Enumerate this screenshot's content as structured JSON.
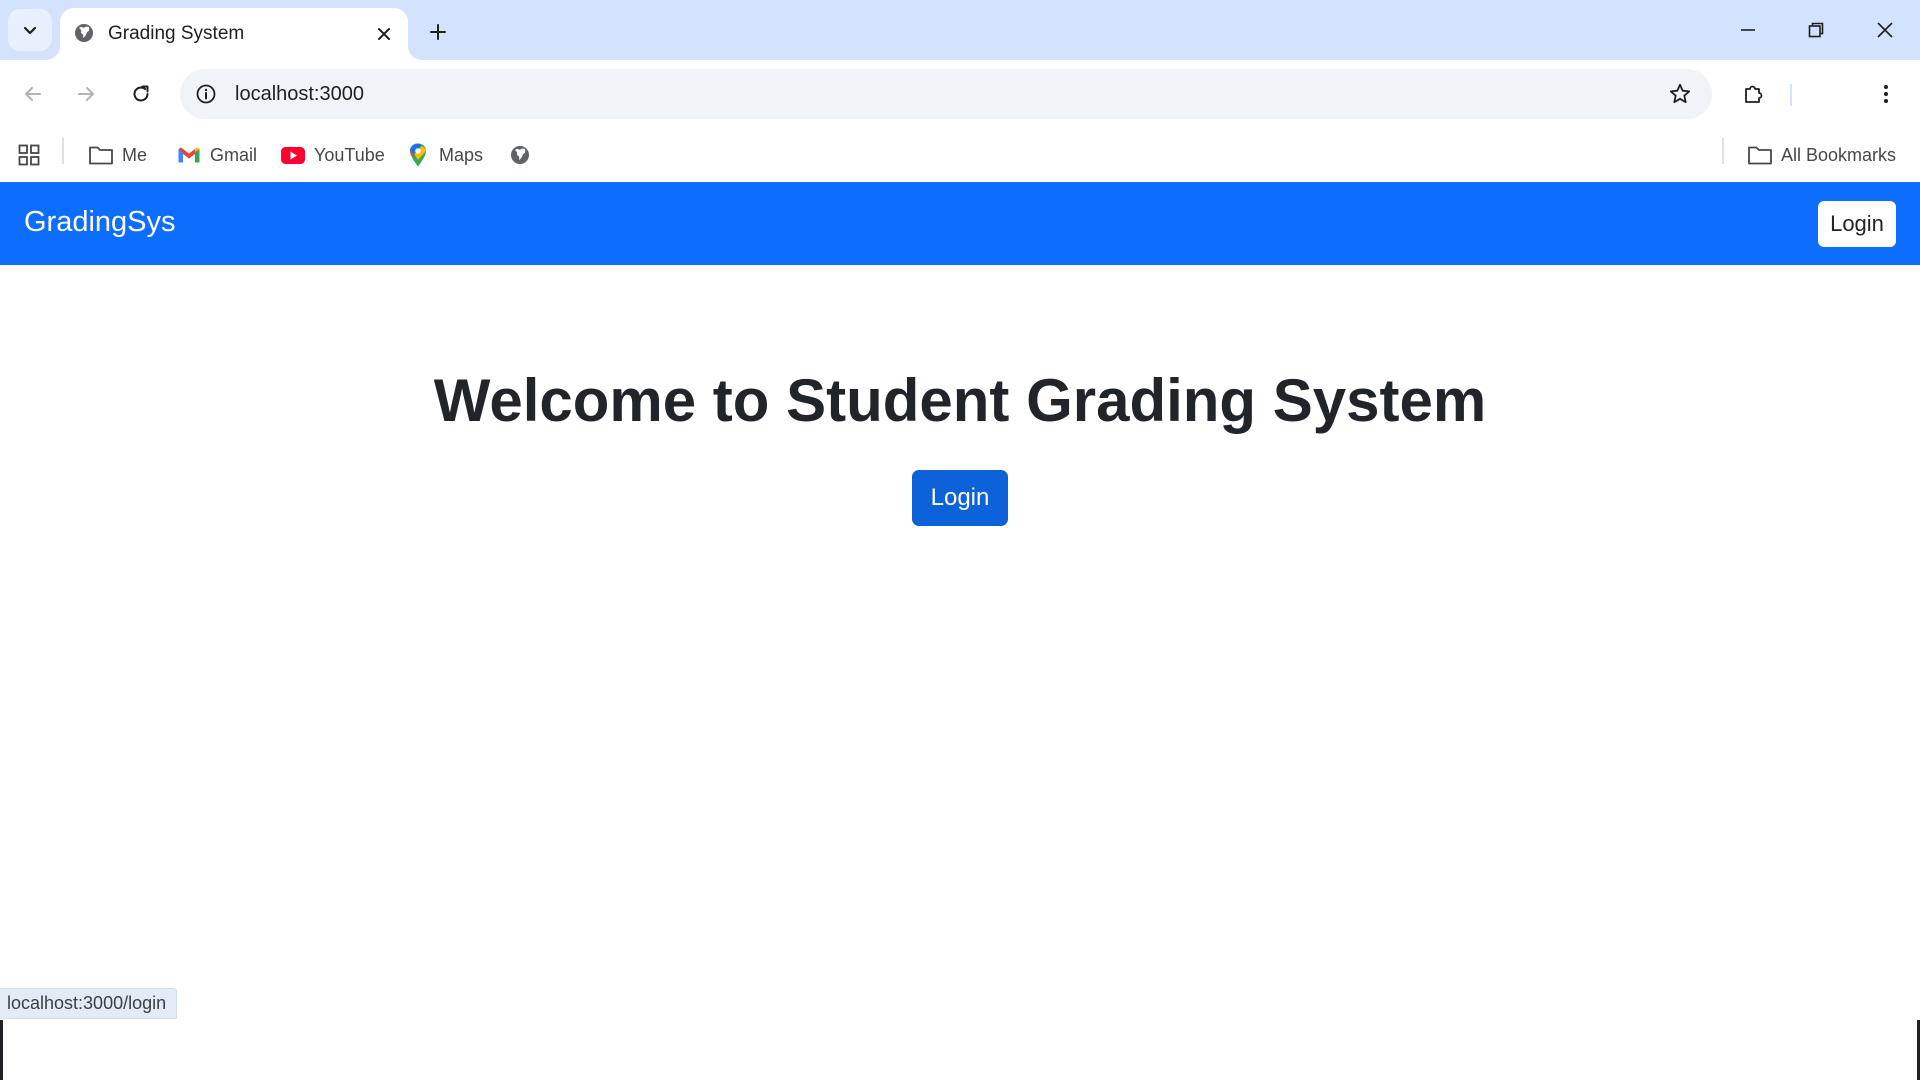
{
  "browser": {
    "tab": {
      "title": "Grading System"
    },
    "address": {
      "url": "localhost:3000"
    },
    "bookmarks": [
      {
        "label": "Me",
        "icon": "folder-icon"
      },
      {
        "label": "Gmail",
        "icon": "gmail-icon"
      },
      {
        "label": "YouTube",
        "icon": "youtube-icon"
      },
      {
        "label": "Maps",
        "icon": "maps-icon"
      }
    ],
    "all_bookmarks_label": "All Bookmarks",
    "status_url": "localhost:3000/login"
  },
  "page": {
    "brand": "GradingSys",
    "nav_login_label": "Login",
    "hero_title": "Welcome to Student Grading System",
    "hero_login_label": "Login"
  },
  "colors": {
    "tab_strip": "#d3e3fd",
    "navbar": "#0d6efd",
    "primary_button": "#0d62d9"
  }
}
